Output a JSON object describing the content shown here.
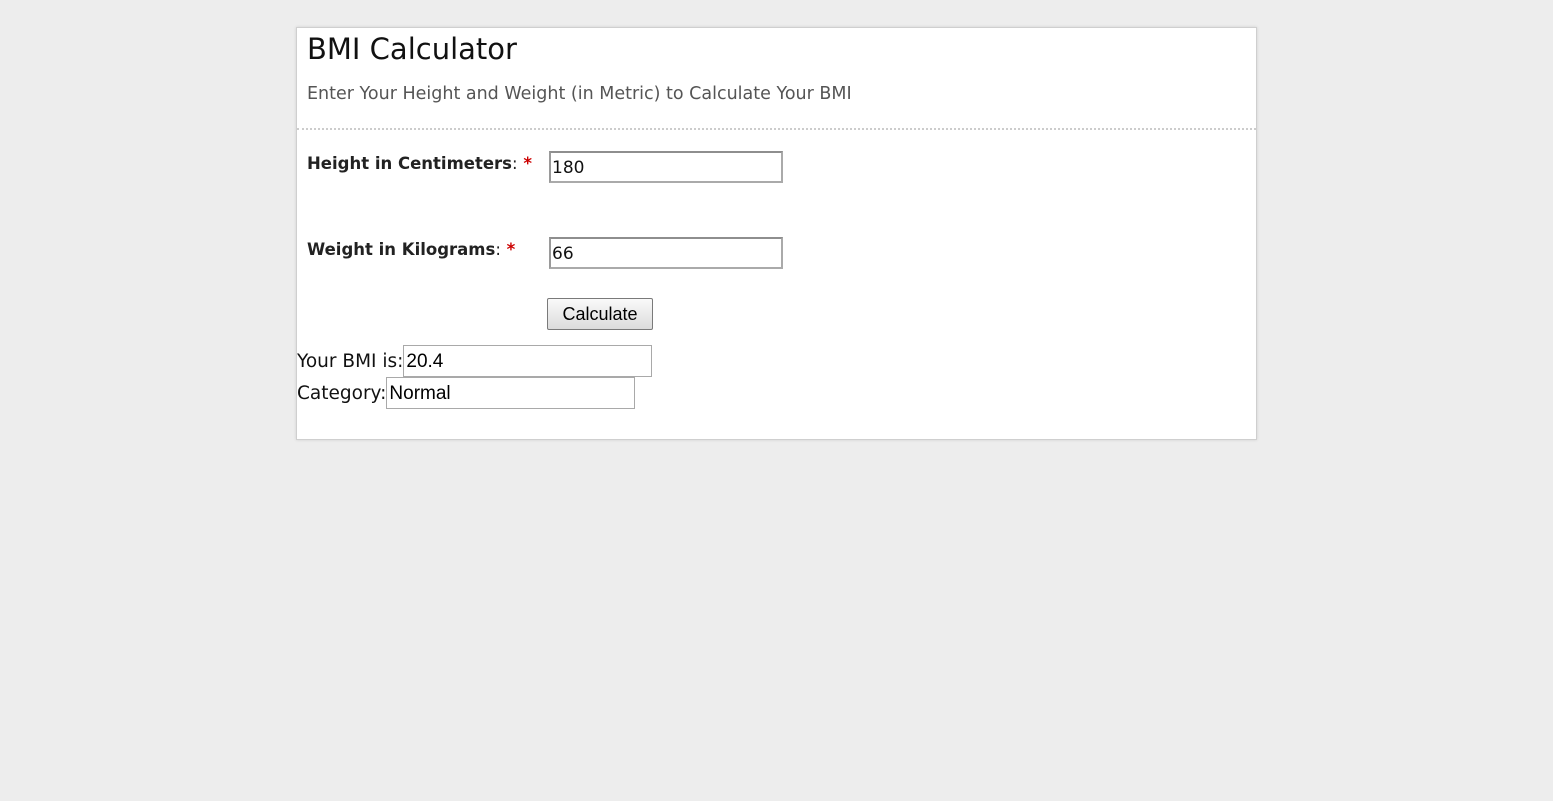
{
  "header": {
    "title": "BMI Calculator",
    "subtitle": "Enter Your Height and Weight (in Metric) to Calculate Your BMI"
  },
  "form": {
    "height": {
      "label": "Height in Centimeters",
      "colon": ":",
      "required_marker": "*",
      "value": "180"
    },
    "weight": {
      "label": "Weight in Kilograms",
      "colon": ":",
      "required_marker": "*",
      "value": "66"
    },
    "calculate_label": "Calculate"
  },
  "results": {
    "bmi_label": "Your BMI is:",
    "bmi_value": "20.4",
    "category_label": "Category:",
    "category_value": "Normal"
  },
  "colors": {
    "page_background": "#ededed",
    "card_background": "#ffffff",
    "required_marker": "#cc0000",
    "subtitle_text": "#555555"
  }
}
